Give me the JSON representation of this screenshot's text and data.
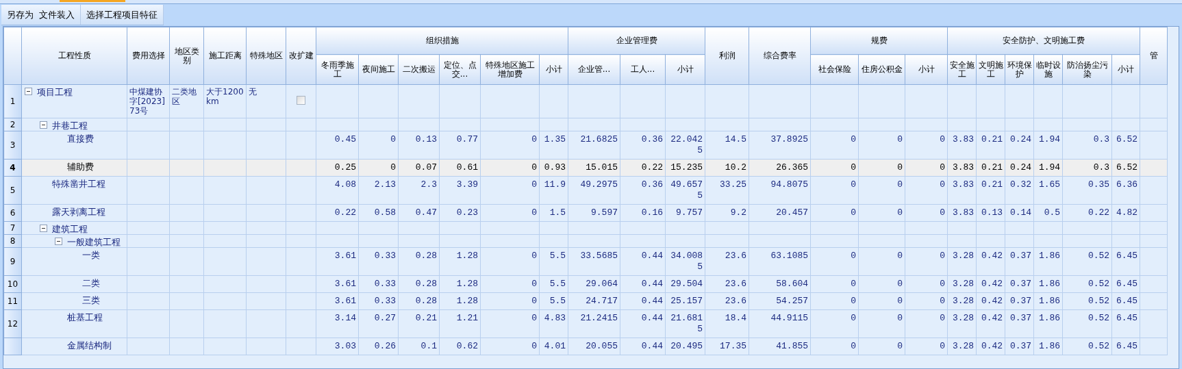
{
  "toolbar": {
    "groups": [
      [
        "另存为",
        "文件装入"
      ],
      [
        "选择工程项目特征"
      ]
    ]
  },
  "table": {
    "columns": [
      {
        "label": "工程性质"
      },
      {
        "label": "费用选择"
      },
      {
        "label": "地区类别"
      },
      {
        "label": "施工距离"
      },
      {
        "label": "特殊地区"
      },
      {
        "label": "改扩建"
      },
      {
        "label": "组织措施",
        "children": [
          {
            "label": "冬雨季施工"
          },
          {
            "label": "夜间施工"
          },
          {
            "label": "二次搬运"
          },
          {
            "label": "定位、点交..."
          },
          {
            "label": "特殊地区施工增加费"
          },
          {
            "label": "小计"
          }
        ]
      },
      {
        "label": "企业管理费",
        "children": [
          {
            "label": "企业管..."
          },
          {
            "label": "工人..."
          },
          {
            "label": "小计"
          }
        ]
      },
      {
        "label": "利润"
      },
      {
        "label": "综合费率"
      },
      {
        "label": "规费",
        "children": [
          {
            "label": "社会保险"
          },
          {
            "label": "住房公积金"
          },
          {
            "label": "小计"
          }
        ]
      },
      {
        "label": "安全防护、文明施工费",
        "children": [
          {
            "label": "安全施工"
          },
          {
            "label": "文明施工"
          },
          {
            "label": "环境保护"
          },
          {
            "label": "临时设施"
          },
          {
            "label": "防治扬尘污染"
          },
          {
            "label": "小计"
          }
        ]
      },
      {
        "label": "管"
      }
    ],
    "rows": [
      {
        "row_number": "1",
        "label": "项目工程",
        "selected": false,
        "expanded": true,
        "fee_option": "中煤建协字[2023]73号",
        "region_class": "二类地区",
        "distance": "大于1200km",
        "special_region": "无",
        "renovation": {
          "checked": false
        },
        "children": [
          {
            "row_number": "2",
            "label": "井巷工程",
            "selected": false,
            "expanded": true,
            "children": [
              {
                "row_number": "3",
                "label": "直接费",
                "selected": false,
                "values": [
                  "0.45",
                  "0",
                  "0.13",
                  "0.77",
                  "0",
                  "1.35",
                  "21.6825",
                  "0.36",
                  "22.0425",
                  "14.5",
                  "37.8925",
                  "0",
                  "0",
                  "0",
                  "3.83",
                  "0.21",
                  "0.24",
                  "1.94",
                  "0.3",
                  "6.52"
                ]
              },
              {
                "row_number": "4",
                "label": "辅助费",
                "selected": true,
                "values": [
                  "0.25",
                  "0",
                  "0.07",
                  "0.61",
                  "0",
                  "0.93",
                  "15.015",
                  "0.22",
                  "15.235",
                  "10.2",
                  "26.365",
                  "0",
                  "0",
                  "0",
                  "3.83",
                  "0.21",
                  "0.24",
                  "1.94",
                  "0.3",
                  "6.52"
                ]
              }
            ]
          },
          {
            "row_number": "5",
            "label": "特殊凿井工程",
            "selected": false,
            "values": [
              "4.08",
              "2.13",
              "2.3",
              "3.39",
              "0",
              "11.9",
              "49.2975",
              "0.36",
              "49.6575",
              "33.25",
              "94.8075",
              "0",
              "0",
              "0",
              "3.83",
              "0.21",
              "0.32",
              "1.65",
              "0.35",
              "6.36"
            ]
          },
          {
            "row_number": "6",
            "label": "露天剥离工程",
            "selected": false,
            "values": [
              "0.22",
              "0.58",
              "0.47",
              "0.23",
              "0",
              "1.5",
              "9.597",
              "0.16",
              "9.757",
              "9.2",
              "20.457",
              "0",
              "0",
              "0",
              "3.83",
              "0.13",
              "0.14",
              "0.5",
              "0.22",
              "4.82"
            ]
          },
          {
            "row_number": "7",
            "label": "建筑工程",
            "selected": false,
            "expanded": true,
            "children": [
              {
                "row_number": "8",
                "label": "一般建筑工程",
                "selected": false,
                "expanded": true,
                "children": [
                  {
                    "row_number": "9",
                    "label": "一类",
                    "selected": false,
                    "values": [
                      "3.61",
                      "0.33",
                      "0.28",
                      "1.28",
                      "0",
                      "5.5",
                      "33.5685",
                      "0.44",
                      "34.0085",
                      "23.6",
                      "63.1085",
                      "0",
                      "0",
                      "0",
                      "3.28",
                      "0.42",
                      "0.37",
                      "1.86",
                      "0.52",
                      "6.45"
                    ]
                  },
                  {
                    "row_number": "10",
                    "label": "二类",
                    "selected": false,
                    "values": [
                      "3.61",
                      "0.33",
                      "0.28",
                      "1.28",
                      "0",
                      "5.5",
                      "29.064",
                      "0.44",
                      "29.504",
                      "23.6",
                      "58.604",
                      "0",
                      "0",
                      "0",
                      "3.28",
                      "0.42",
                      "0.37",
                      "1.86",
                      "0.52",
                      "6.45"
                    ]
                  },
                  {
                    "row_number": "11",
                    "label": "三类",
                    "selected": false,
                    "values": [
                      "3.61",
                      "0.33",
                      "0.28",
                      "1.28",
                      "0",
                      "5.5",
                      "24.717",
                      "0.44",
                      "25.157",
                      "23.6",
                      "54.257",
                      "0",
                      "0",
                      "0",
                      "3.28",
                      "0.42",
                      "0.37",
                      "1.86",
                      "0.52",
                      "6.45"
                    ]
                  }
                ]
              },
              {
                "row_number": "12",
                "label": "桩基工程",
                "selected": false,
                "values": [
                  "3.14",
                  "0.27",
                  "0.21",
                  "1.21",
                  "0",
                  "4.83",
                  "21.2415",
                  "0.44",
                  "21.6815",
                  "18.4",
                  "44.9115",
                  "0",
                  "0",
                  "0",
                  "3.28",
                  "0.42",
                  "0.37",
                  "1.86",
                  "0.52",
                  "6.45"
                ]
              },
              {
                "label": "金属结构制",
                "selected": false,
                "values": [
                  "3.03",
                  "0.26",
                  "0.1",
                  "0.62",
                  "0",
                  "4.01",
                  "20.055",
                  "0.44",
                  "20.495",
                  "17.35",
                  "41.855",
                  "0",
                  "0",
                  "0",
                  "3.28",
                  "0.42",
                  "0.37",
                  "1.86",
                  "0.52",
                  "6.45"
                ]
              }
            ]
          }
        ]
      }
    ]
  }
}
